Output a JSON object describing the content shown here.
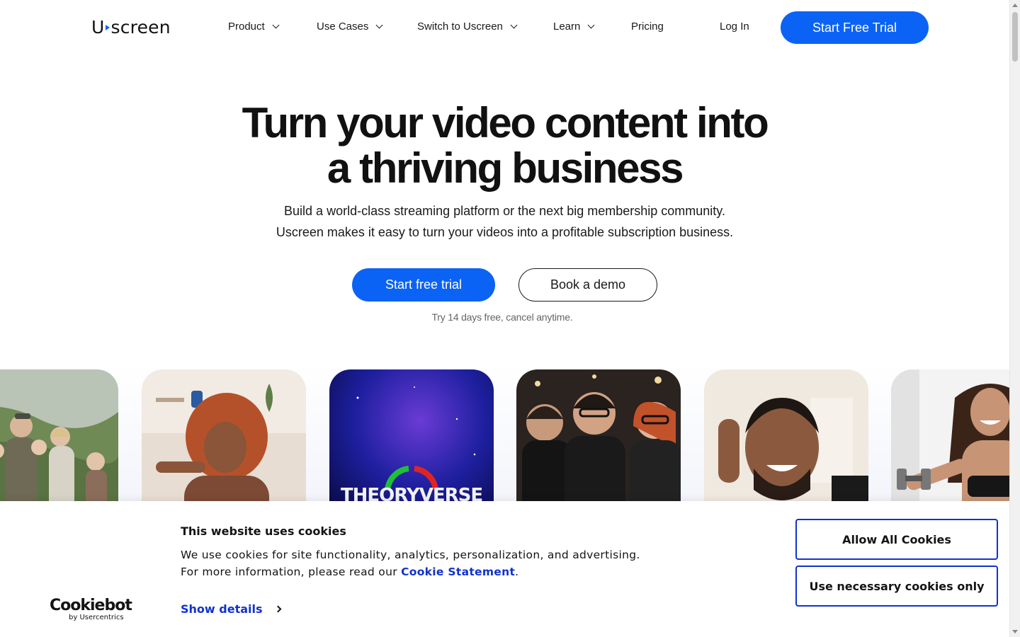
{
  "header": {
    "logo_text_start": "U",
    "logo_text_end": "screen",
    "nav": [
      {
        "label": "Product",
        "dropdown": true
      },
      {
        "label": "Use Cases",
        "dropdown": true
      },
      {
        "label": "Switch to Uscreen",
        "dropdown": true
      },
      {
        "label": "Learn",
        "dropdown": true
      },
      {
        "label": "Pricing",
        "dropdown": false
      }
    ],
    "login_label": "Log In",
    "trial_label": "Start Free Trial"
  },
  "hero": {
    "title_line1": "Turn your video content into",
    "title_line2": "a thriving business",
    "subtitle_line1": "Build a world-class streaming platform or the next big membership community.",
    "subtitle_line2": "Uscreen makes it easy to turn your videos into a profitable subscription business.",
    "primary_cta": "Start free trial",
    "secondary_cta": "Book a demo",
    "note": "Try 14 days free, cancel anytime."
  },
  "carousel": {
    "cards": [
      {
        "name": "family-photo"
      },
      {
        "name": "woman-portrait"
      },
      {
        "name": "theoryverse",
        "label": "THEORYVERSE"
      },
      {
        "name": "three-hosts-photo"
      },
      {
        "name": "smiling-man-photo"
      },
      {
        "name": "fitness-woman-photo"
      }
    ]
  },
  "cookie_banner": {
    "title": "This website uses cookies",
    "text_line1": "We use cookies for site functionality, analytics, personalization, and advertising.",
    "text_line2_prefix": "For more information, please read our ",
    "link_label": "Cookie Statement",
    "text_line2_suffix": ".",
    "show_details": "Show details",
    "allow_all": "Allow All Cookies",
    "necessary_only": "Use necessary cookies only",
    "brand": "Cookiebot",
    "brand_sub": "by Usercentrics"
  },
  "colors": {
    "accent": "#0b63f6",
    "cookie_link": "#1032cf"
  }
}
